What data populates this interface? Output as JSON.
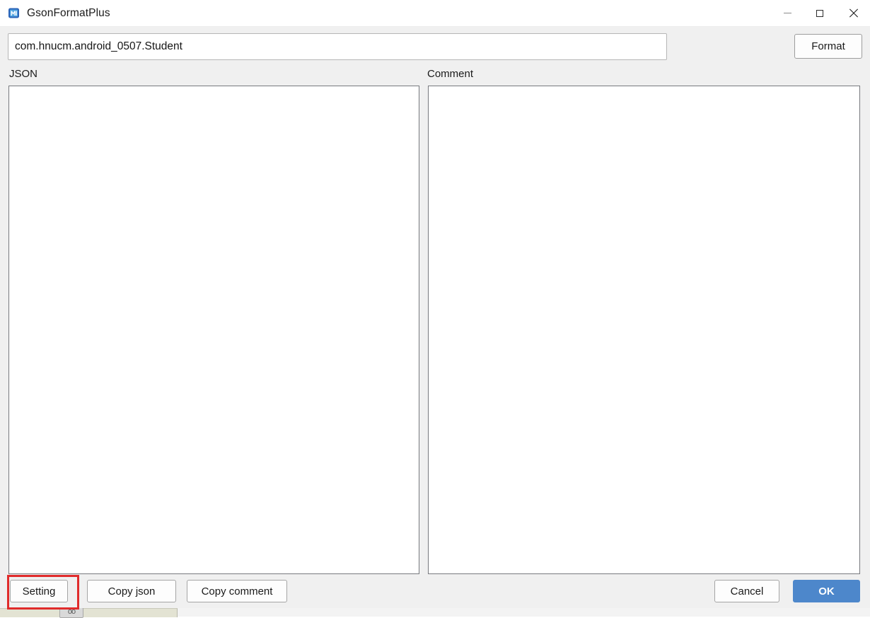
{
  "window": {
    "title": "GsonFormatPlus",
    "icon": "app-icon",
    "controls": {
      "minimize": "minimize-icon",
      "maximize": "maximize-icon",
      "close": "close-icon"
    }
  },
  "toolbar": {
    "class_name_value": "com.hnucm.android_0507.Student",
    "class_name_placeholder": "",
    "format_label": "Format"
  },
  "panels": {
    "json": {
      "label": "JSON",
      "value": "",
      "placeholder": ""
    },
    "comment": {
      "label": "Comment",
      "value": "",
      "placeholder": ""
    }
  },
  "buttons": {
    "setting_label": "Setting",
    "copy_json_label": "Copy  json",
    "copy_comment_label": "Copy comment",
    "cancel_label": "Cancel",
    "ok_label": "OK"
  },
  "annotation": {
    "target": "setting-button",
    "color": "#e02b2b"
  },
  "colors": {
    "accent": "#4d87cb",
    "window_background": "#f0f0f0",
    "titlebar_background": "#ffffff",
    "panel_border": "#77797e",
    "highlight": "#e02b2b"
  },
  "desktop": {
    "chip_label": "oo"
  }
}
